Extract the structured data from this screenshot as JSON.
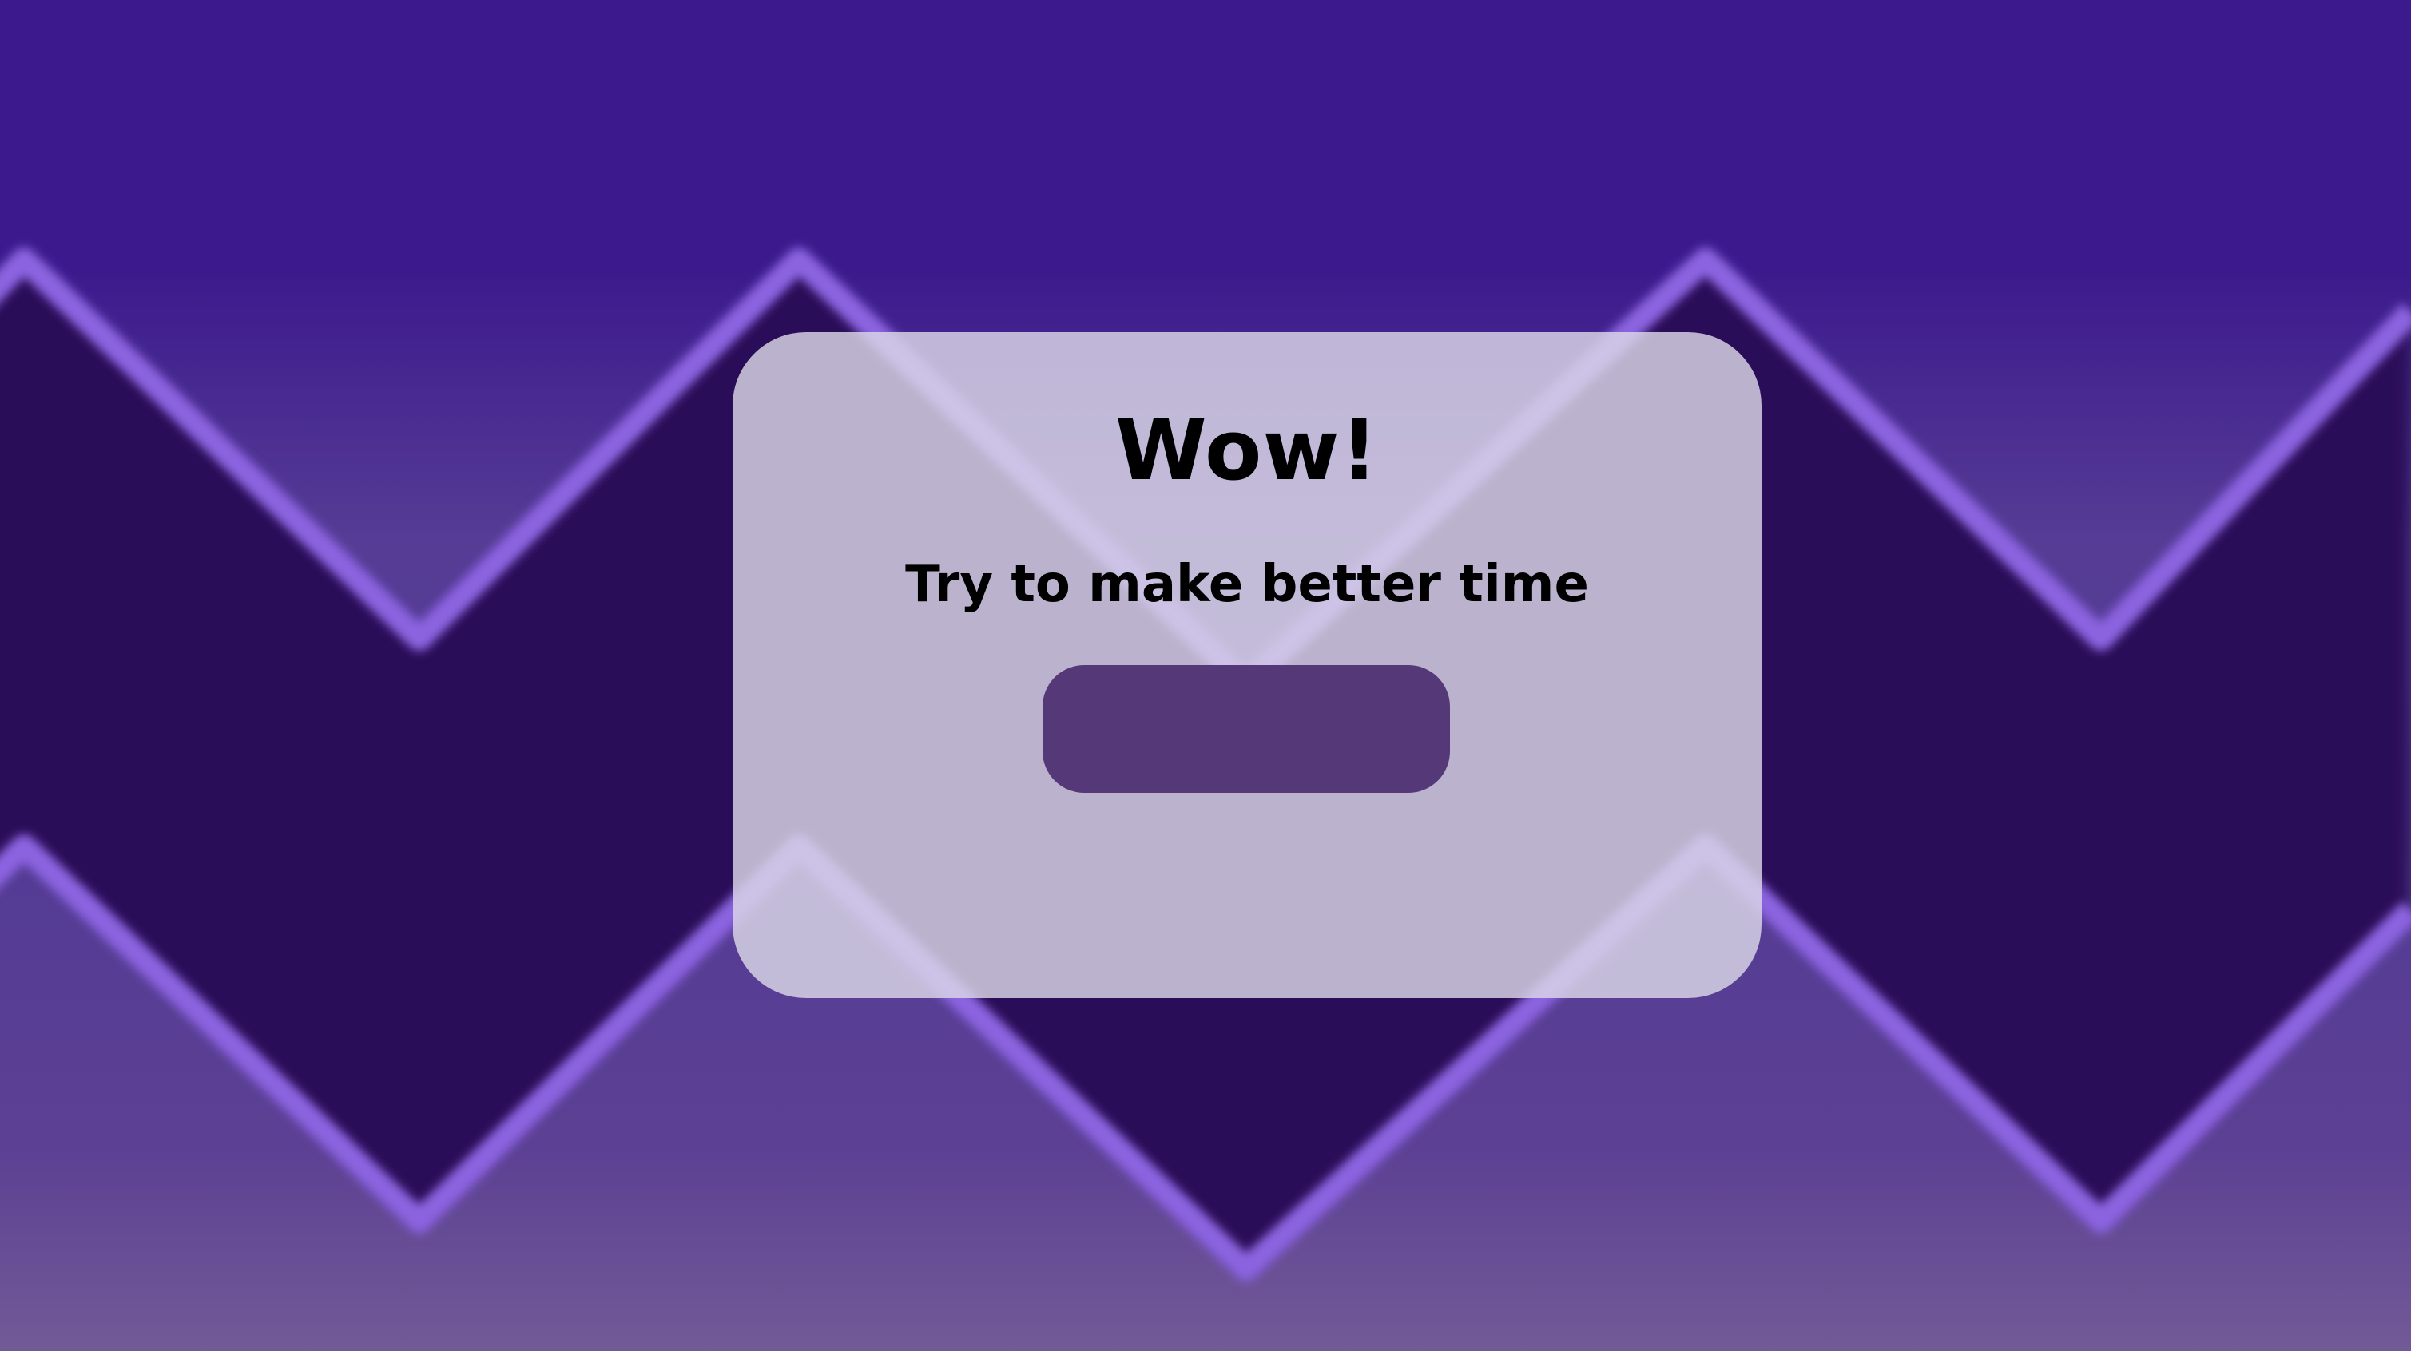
{
  "dialog": {
    "title": "Wow!",
    "message": "Try to make better time",
    "button_label": ""
  },
  "colors": {
    "background_top": "#3c1a8d",
    "background_bottom": "#725a96",
    "zigzag_band": "#2c0e58",
    "zigzag_glow": "#8b63e0",
    "dialog_fill": "#dcd8e8",
    "button_fill": "#543878"
  }
}
